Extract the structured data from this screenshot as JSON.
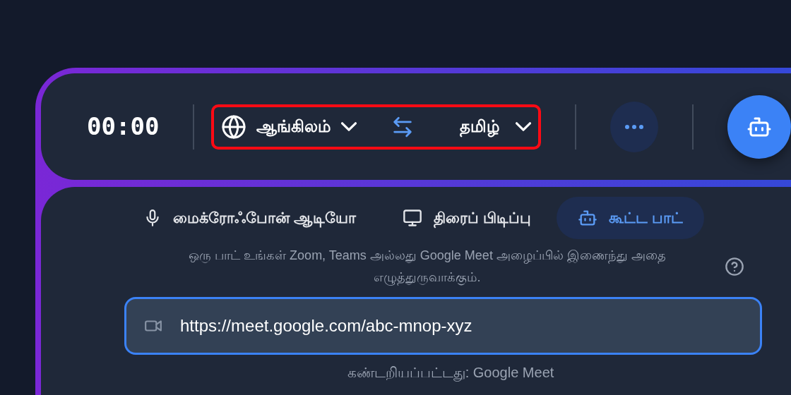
{
  "toolbar": {
    "timer": "00:00",
    "language_selector": {
      "highlighted": true,
      "source": "ஆங்கிலம்",
      "target": "தமிழ்"
    },
    "more_button": {
      "kind": "dots"
    },
    "bot_button": {
      "kind": "bot"
    }
  },
  "tabs": [
    {
      "label": "மைக்ரோஃபோன் ஆடியோ",
      "kind": "mic",
      "selected": false
    },
    {
      "label": "திரைப் பிடிப்பு",
      "kind": "screen",
      "selected": false
    },
    {
      "label": "கூட்ட பாட்",
      "kind": "bot",
      "selected": true
    }
  ],
  "description": "ஒரு பாட் உங்கள் Zoom, Teams அல்லது Google Meet அழைப்பில் இணைந்து அதை எழுத்துருவாக்கும்.",
  "meeting_link": {
    "value": "https://meet.google.com/abc-mnop-xyz",
    "focused": true
  },
  "detected": "கண்டறியப்பட்டது: Google Meet"
}
